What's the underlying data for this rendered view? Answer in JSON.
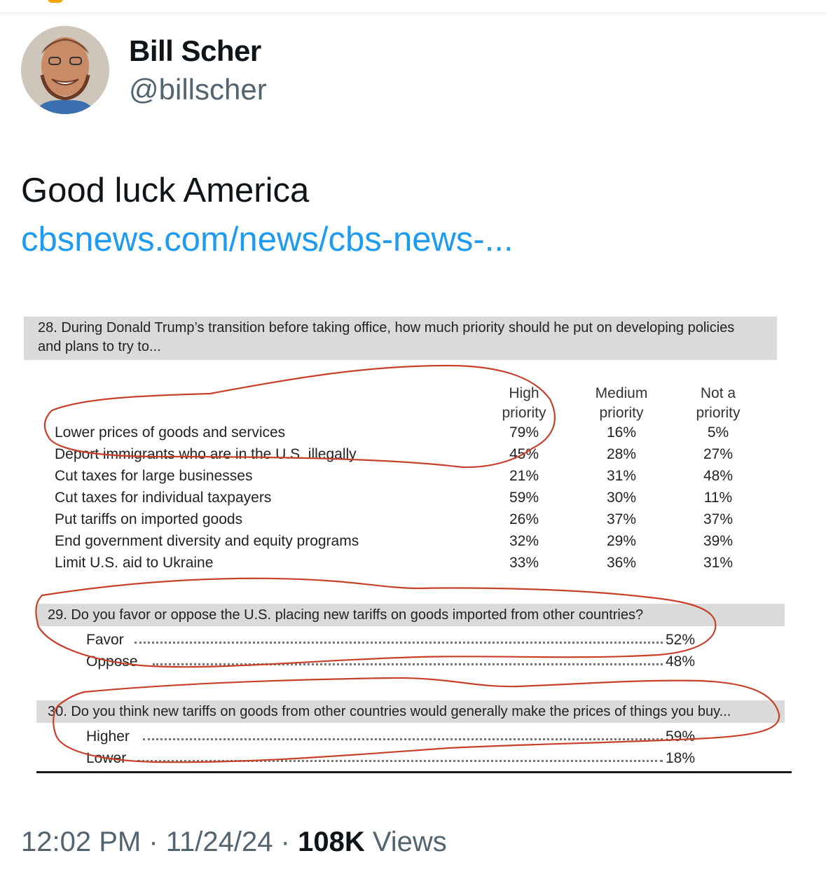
{
  "author": {
    "name": "Bill Scher",
    "handle": "@billscher"
  },
  "tweet": {
    "text": "Good luck America",
    "link": "cbsnews.com/news/cbs-news-..."
  },
  "poll": {
    "q28": {
      "question": "28. During Donald Trump’s transition before taking office, how much priority should he put on developing policies",
      "question_line2": "and plans to try to...",
      "columns": [
        {
          "line1": "High",
          "line2": "priority"
        },
        {
          "line1": "Medium",
          "line2": "priority"
        },
        {
          "line1": "Not a",
          "line2": "priority"
        }
      ],
      "rows": [
        {
          "label": "Lower prices of goods and services",
          "values": [
            "79%",
            "16%",
            "5%"
          ]
        },
        {
          "label": "Deport immigrants who are in the U.S. illegally",
          "values": [
            "45%",
            "28%",
            "27%"
          ]
        },
        {
          "label": "Cut taxes for large businesses",
          "values": [
            "21%",
            "31%",
            "48%"
          ]
        },
        {
          "label": "Cut taxes for individual taxpayers",
          "values": [
            "59%",
            "30%",
            "11%"
          ]
        },
        {
          "label": "Put tariffs on imported goods",
          "values": [
            "26%",
            "37%",
            "37%"
          ]
        },
        {
          "label": "End government diversity and equity programs",
          "values": [
            "32%",
            "29%",
            "39%"
          ]
        },
        {
          "label": "Limit U.S. aid to Ukraine",
          "values": [
            "33%",
            "36%",
            "31%"
          ]
        }
      ]
    },
    "q29": {
      "question": "29. Do you favor or oppose the U.S. placing new tariffs on goods imported from other countries?",
      "answers": [
        {
          "label": "Favor",
          "value": "52%"
        },
        {
          "label": "Oppose",
          "value": "48%"
        }
      ]
    },
    "q30": {
      "question": "30. Do you think new tariffs on goods from other countries would generally make the prices of things you buy...",
      "answers": [
        {
          "label": "Higher",
          "value": "59%"
        },
        {
          "label": "Lower",
          "value": "18%"
        }
      ]
    }
  },
  "meta": {
    "time": "12:02 PM",
    "date": "11/24/24",
    "views_count": "108K",
    "views_label": "Views"
  },
  "colors": {
    "link": "#1d9bf0",
    "annotation": "#c8402a",
    "muted": "#536471"
  }
}
